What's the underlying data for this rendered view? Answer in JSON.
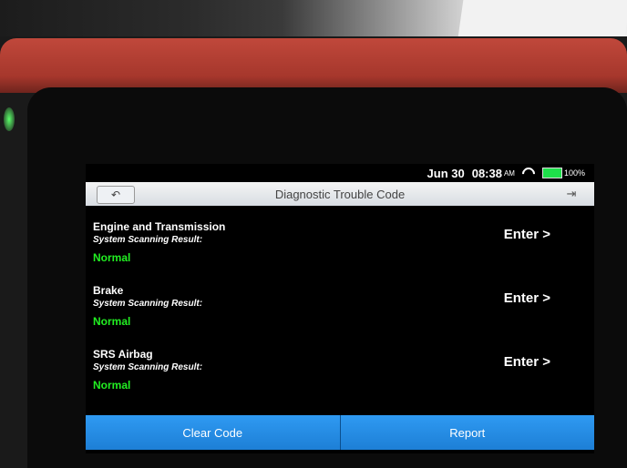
{
  "status_bar": {
    "date": "Jun 30",
    "time": "08:38",
    "ampm": "AM",
    "battery": "100%"
  },
  "header": {
    "title": "Diagnostic Trouble Code",
    "back_icon": "back-arrow-icon",
    "exit_icon": "exit-door-icon"
  },
  "systems": [
    {
      "name": "Engine and Transmission",
      "subtitle": "System Scanning Result:",
      "status": "Normal",
      "action": "Enter >"
    },
    {
      "name": "Brake",
      "subtitle": "System Scanning Result:",
      "status": "Normal",
      "action": "Enter >"
    },
    {
      "name": "SRS Airbag",
      "subtitle": "System Scanning Result:",
      "status": "Normal",
      "action": "Enter >"
    }
  ],
  "footer": {
    "clear_label": "Clear Code",
    "report_label": "Report"
  },
  "colors": {
    "status_normal": "#22ee22",
    "button_blue": "#1d7fd6",
    "battery_green": "#1ee04a"
  }
}
